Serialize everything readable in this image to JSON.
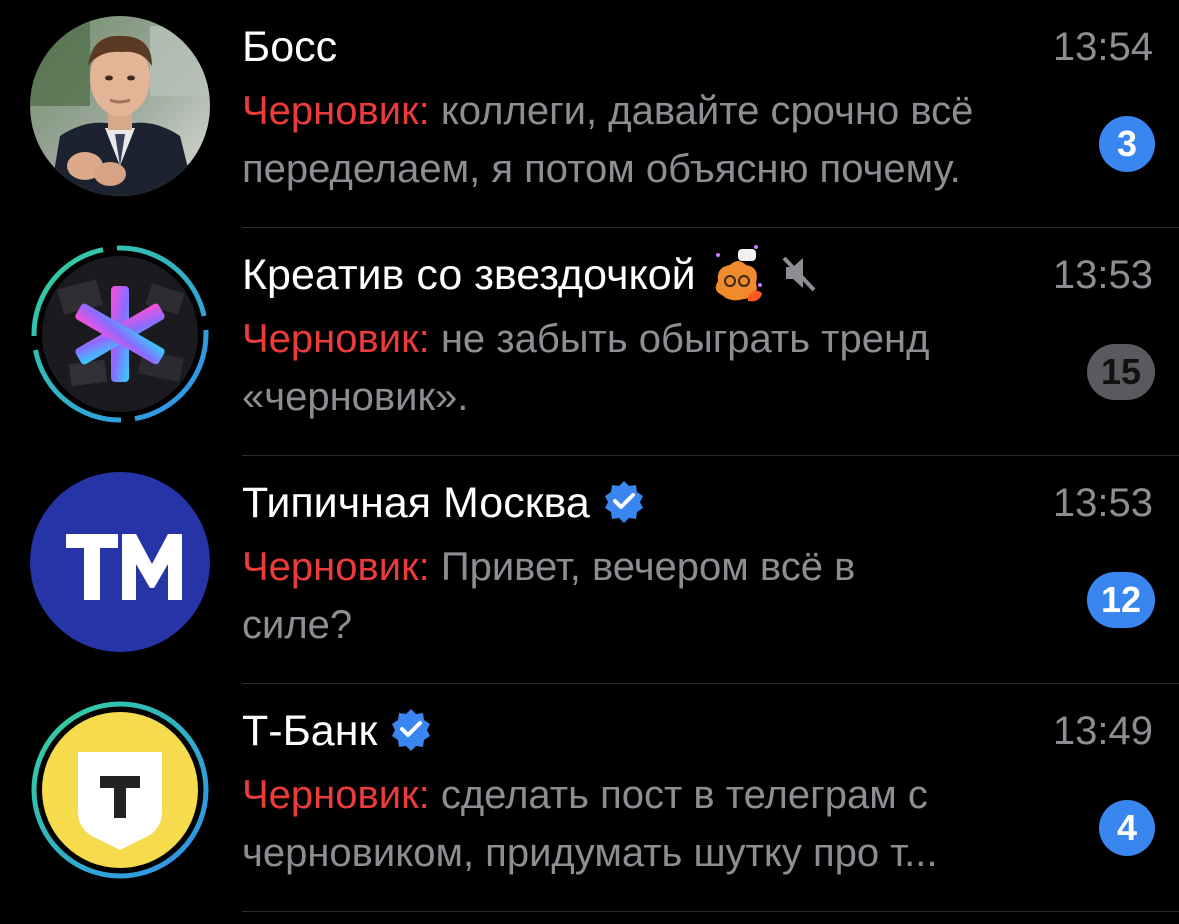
{
  "chats": [
    {
      "name": "Босс",
      "time": "13:54",
      "draft_label": "Черновик:",
      "preview": "коллеги, давайте срочно всё переделаем, я потом объясню почему.",
      "unread": "3",
      "avatar_icon": "person-photo",
      "muted": false,
      "verified": false
    },
    {
      "name": "Креатив со звездочкой",
      "time": "13:53",
      "draft_label": "Черновик:",
      "preview": "не забыть обыграть тренд «черновик».",
      "unread": "15",
      "avatar_icon": "asterisk-logo",
      "emoji_icon": "sticker-emoji",
      "muted": true,
      "verified": false
    },
    {
      "name": "Типичная Москва",
      "time": "13:53",
      "draft_label": "Черновик:",
      "preview": "Привет, вечером всё в силе?",
      "unread": "12",
      "avatar_icon": "tm-logo",
      "muted": false,
      "verified": true
    },
    {
      "name": "Т-Банк",
      "time": "13:49",
      "draft_label": "Черновик:",
      "preview": "сделать пост в телеграм с черновиком, придумать шутку про т...",
      "unread": "4",
      "avatar_icon": "t-bank-shield-logo",
      "muted": false,
      "verified": true
    }
  ],
  "colors": {
    "background": "#000000",
    "draft_red": "#ec3b3b",
    "badge_blue": "#3a86f0",
    "badge_muted": "#5a5a5e",
    "secondary_text": "#8d8d93",
    "verified_blue": "#3a86f0"
  }
}
